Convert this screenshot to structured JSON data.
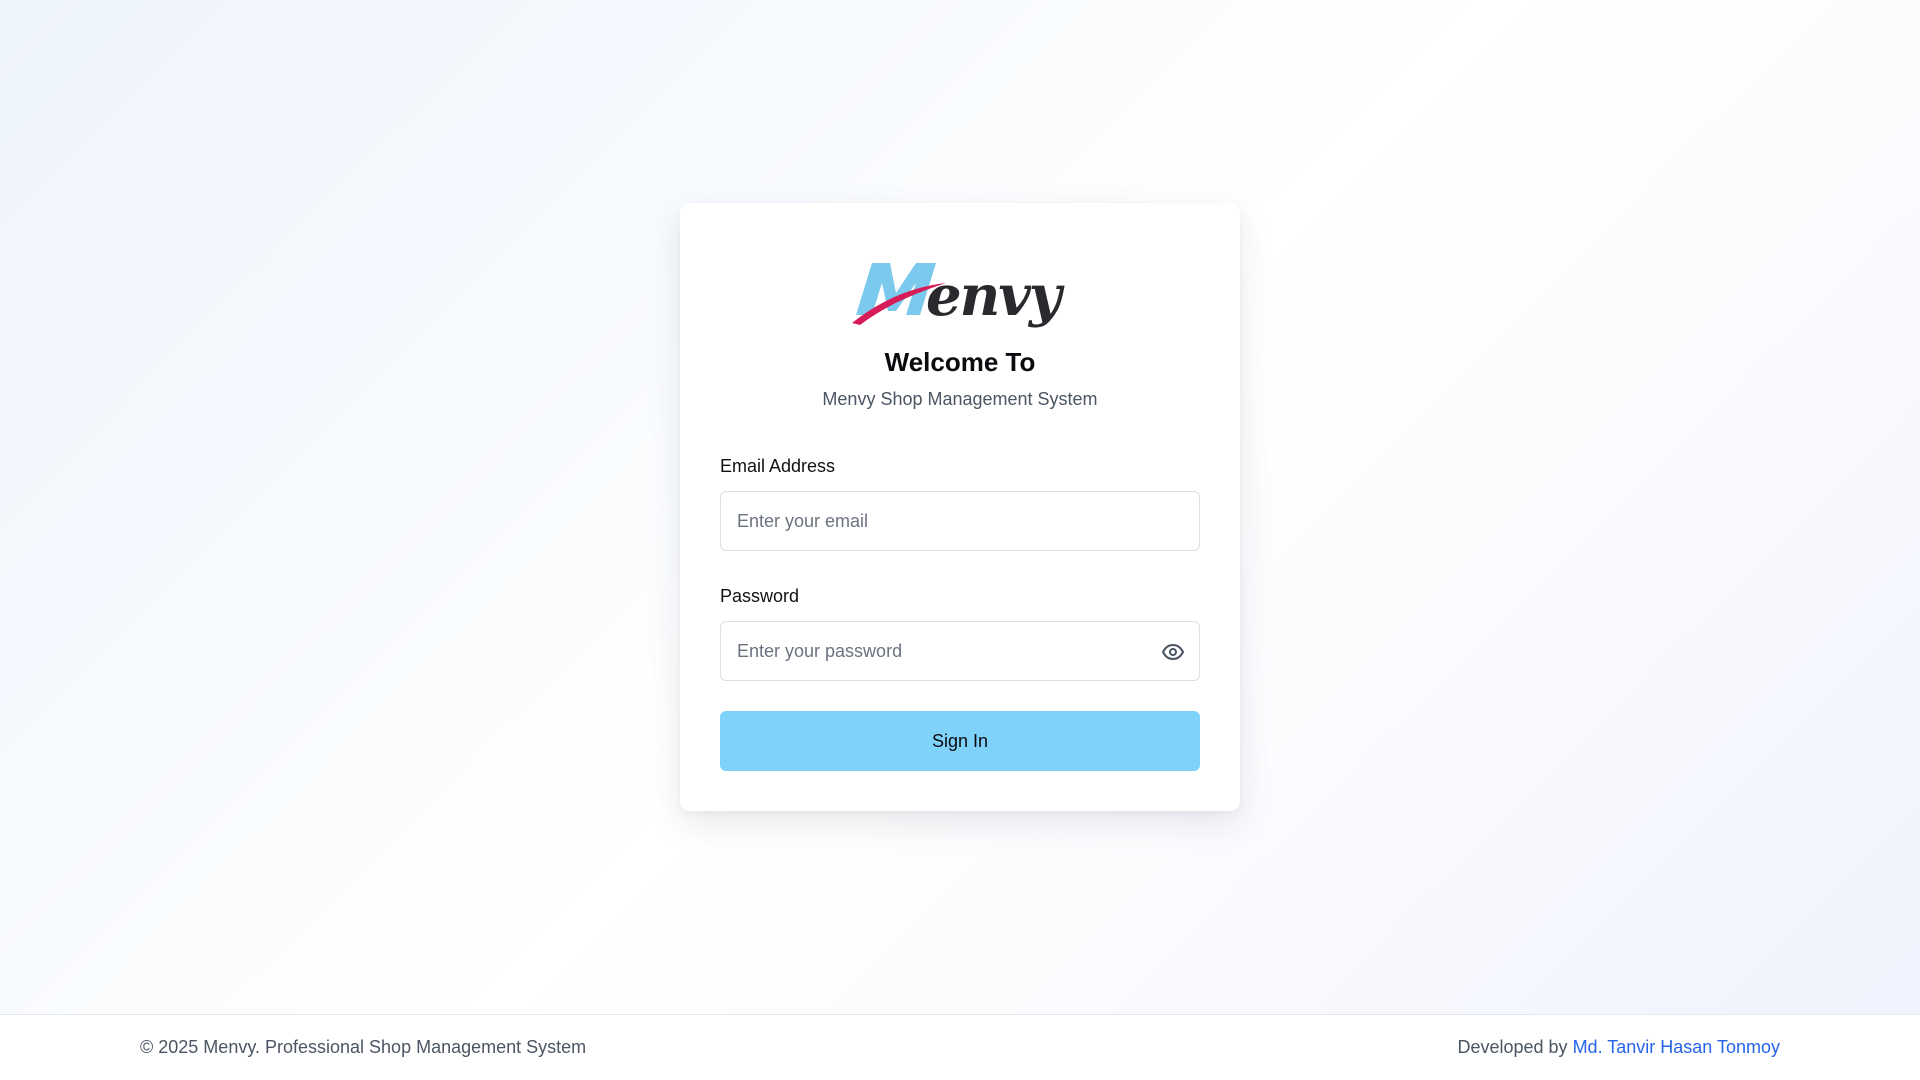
{
  "logo": {
    "text": "Menvy",
    "colors": {
      "m": "#7cc9ee",
      "swoosh": "#d61c58",
      "text": "#2a2a2e"
    }
  },
  "card": {
    "title": "Welcome To",
    "subtitle": "Menvy Shop Management System"
  },
  "form": {
    "email": {
      "label": "Email Address",
      "placeholder": "Enter your email",
      "value": ""
    },
    "password": {
      "label": "Password",
      "placeholder": "Enter your password",
      "value": ""
    },
    "submit_label": "Sign In"
  },
  "footer": {
    "copyright": "© 2025 Menvy. Professional Shop Management System",
    "developed_by": "Developed by",
    "developer_name": "Md. Tanvir Hasan Tonmoy"
  },
  "colors": {
    "accent": "#7fd3fa",
    "link": "#2563eb"
  },
  "icons": {
    "password_toggle": "eye-icon"
  }
}
